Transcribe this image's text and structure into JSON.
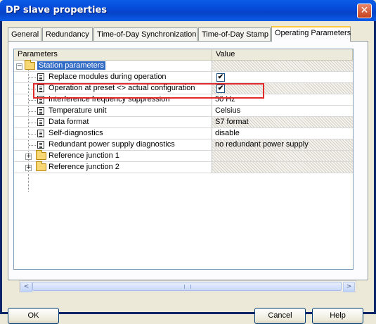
{
  "window": {
    "title": "DP slave properties"
  },
  "tabs": [
    {
      "label": "General"
    },
    {
      "label": "Redundancy"
    },
    {
      "label": "Time-of-Day Synchronization"
    },
    {
      "label": "Time-of-Day Stamp"
    },
    {
      "label": "Operating Parameters"
    }
  ],
  "grid": {
    "columns": {
      "param": "Parameters",
      "value": "Value"
    },
    "rows": [
      {
        "label": "Station parameters",
        "value": ""
      },
      {
        "label": "Replace modules during operation",
        "value": "✔"
      },
      {
        "label": "Operation at preset <> actual configuration",
        "value": "✔"
      },
      {
        "label": "Interference frequency suppression",
        "value": "50 Hz"
      },
      {
        "label": "Temperature unit",
        "value": "Celsius"
      },
      {
        "label": "Data format",
        "value": "S7 format"
      },
      {
        "label": "Self-diagnostics",
        "value": "disable"
      },
      {
        "label": "Redundant power supply diagnostics",
        "value": "no redundant power supply"
      },
      {
        "label": "Reference junction 1",
        "value": ""
      },
      {
        "label": "Reference junction 2",
        "value": ""
      }
    ]
  },
  "buttons": {
    "ok": "OK",
    "cancel": "Cancel",
    "help": "Help"
  },
  "scrollbar": {
    "left_arrow": "<",
    "right_arrow": ">"
  }
}
